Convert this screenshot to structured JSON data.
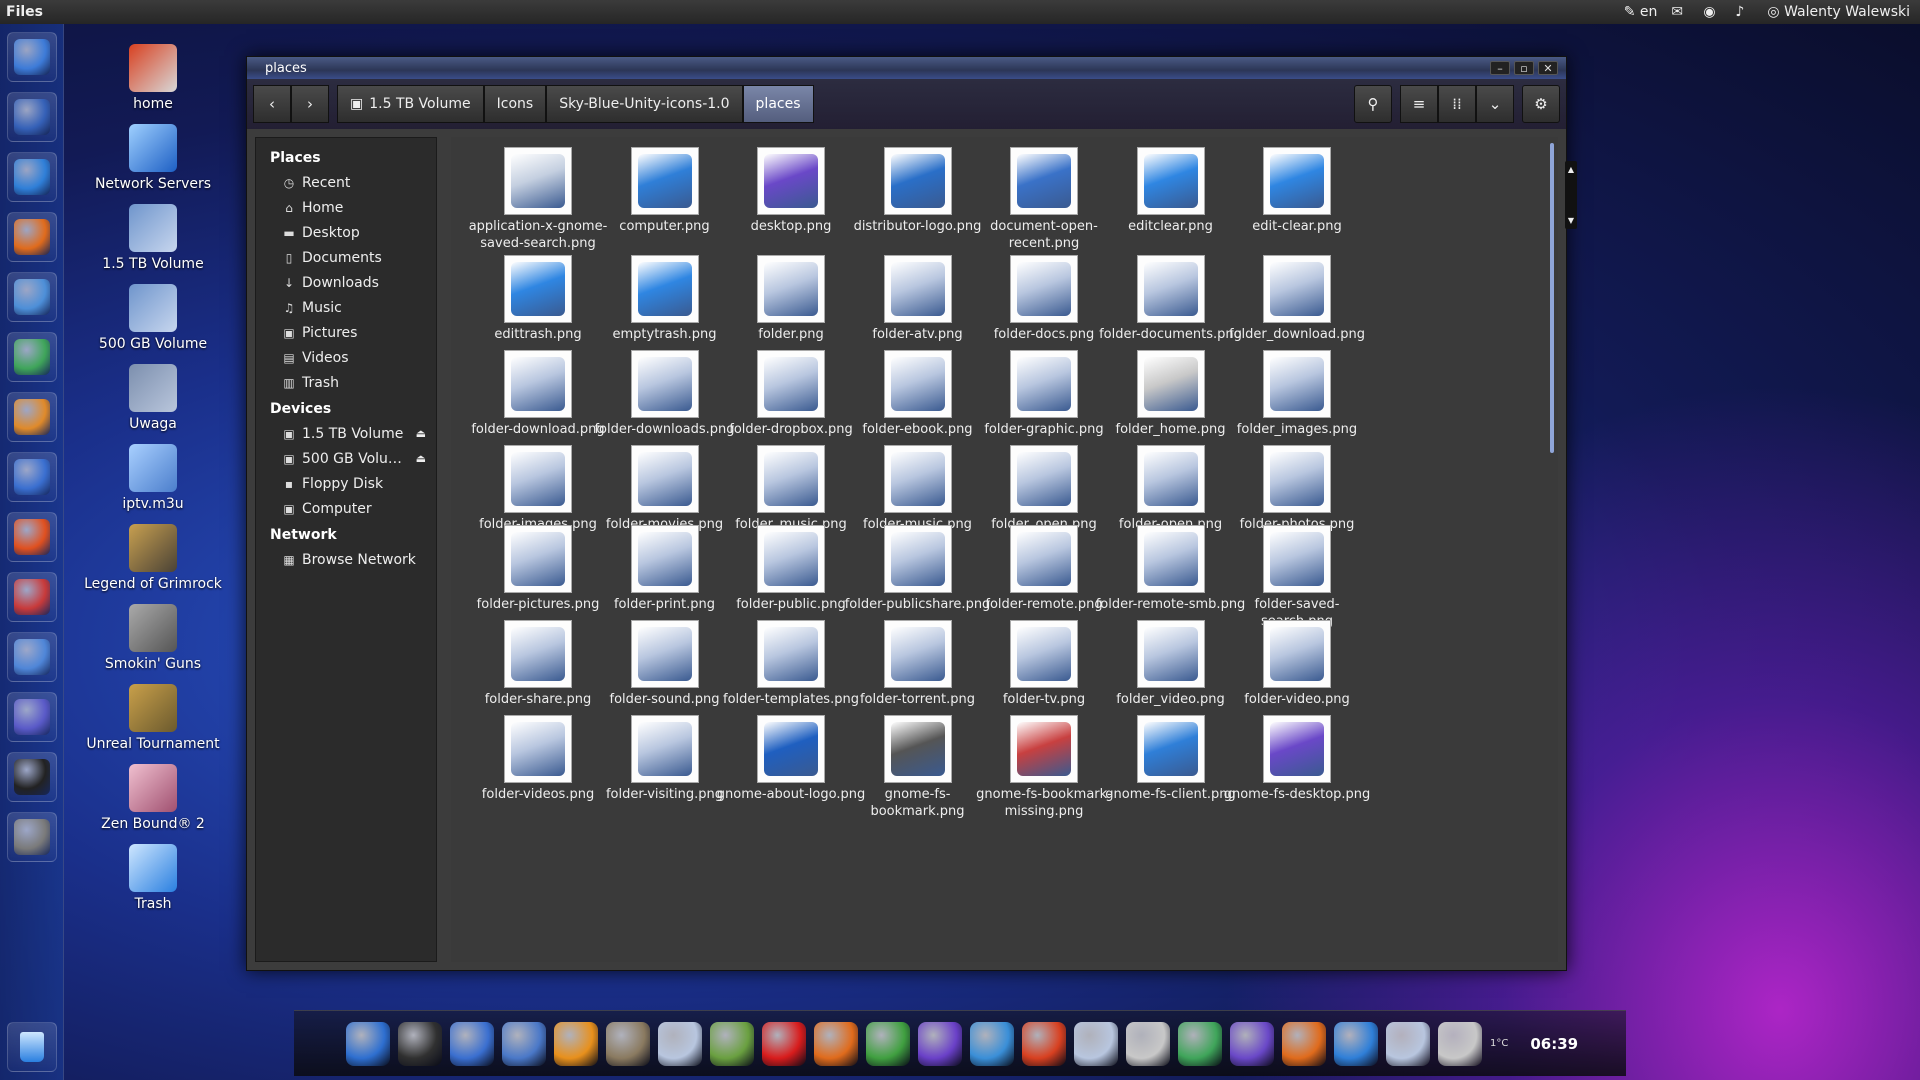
{
  "topbar": {
    "app_title": "Files",
    "keyboard": "en",
    "user": "Walenty Walewski"
  },
  "desktop_icons": [
    {
      "label": "home",
      "color": "#d8d8d8",
      "accent": "#d84020"
    },
    {
      "label": "Network Servers",
      "color": "#1d5fc4",
      "accent": "#9fd0ff"
    },
    {
      "label": "1.5 TB Volume",
      "color": "#c7d6ee",
      "accent": "#6f95cc"
    },
    {
      "label": "500 GB Volume",
      "color": "#c7d6ee",
      "accent": "#6f95cc"
    },
    {
      "label": "Uwaga",
      "color": "#b9c6dc",
      "accent": "#7c8fae"
    },
    {
      "label": "iptv.m3u",
      "color": "#4b7ecc",
      "accent": "#a9d0ff"
    },
    {
      "label": "Legend of Grimrock",
      "color": "#4a4236",
      "accent": "#c8a050"
    },
    {
      "label": "Smokin' Guns",
      "color": "#555555",
      "accent": "#aaaaaa"
    },
    {
      "label": "Unreal Tournament",
      "color": "#6b5a2e",
      "accent": "#c9a04a"
    },
    {
      "label": "Zen Bound® 2",
      "color": "#a05070",
      "accent": "#f0c0d0"
    },
    {
      "label": "Trash",
      "color": "#2a7fe0",
      "accent": "#cfe7ff"
    }
  ],
  "window": {
    "title": "places",
    "breadcrumbs": [
      "1.5 TB Volume",
      "Icons",
      "Sky-Blue-Unity-icons-1.0",
      "places"
    ]
  },
  "sidebar": {
    "places_heading": "Places",
    "places": [
      {
        "label": "Recent",
        "icon": "◷"
      },
      {
        "label": "Home",
        "icon": "⌂"
      },
      {
        "label": "Desktop",
        "icon": "▬"
      },
      {
        "label": "Documents",
        "icon": "▯"
      },
      {
        "label": "Downloads",
        "icon": "↓"
      },
      {
        "label": "Music",
        "icon": "♫"
      },
      {
        "label": "Pictures",
        "icon": "▣"
      },
      {
        "label": "Videos",
        "icon": "▤"
      },
      {
        "label": "Trash",
        "icon": "▥"
      }
    ],
    "devices_heading": "Devices",
    "devices": [
      {
        "label": "1.5 TB Volume",
        "eject": true
      },
      {
        "label": "500 GB Volu…",
        "eject": true
      },
      {
        "label": "Floppy Disk",
        "eject": false
      },
      {
        "label": "Computer",
        "eject": false
      }
    ],
    "network_heading": "Network",
    "network": [
      {
        "label": "Browse Network"
      }
    ]
  },
  "files": [
    {
      "name": "application-x-gnome-saved-search.png",
      "color": "#c4cfe0"
    },
    {
      "name": "computer.png",
      "color": "#2f7fd8"
    },
    {
      "name": "desktop.png",
      "color": "#6a48c8"
    },
    {
      "name": "distributor-logo.png",
      "color": "#2a6fc8"
    },
    {
      "name": "document-open-recent.png",
      "color": "#3a72c8"
    },
    {
      "name": "editclear.png",
      "color": "#2f86e2"
    },
    {
      "name": "edit-clear.png",
      "color": "#2f86e2"
    },
    {
      "name": "edittrash.png",
      "color": "#2f86e2"
    },
    {
      "name": "emptytrash.png",
      "color": "#2f86e2"
    },
    {
      "name": "folder.png",
      "color": "#b8c6df"
    },
    {
      "name": "folder-atv.png",
      "color": "#b8c6df"
    },
    {
      "name": "folder-docs.png",
      "color": "#b8c6df"
    },
    {
      "name": "folder-documents.png",
      "color": "#b8c6df"
    },
    {
      "name": "folder_download.png",
      "color": "#b8c6df"
    },
    {
      "name": "folder-download.png",
      "color": "#b8c6df"
    },
    {
      "name": "folder-downloads.png",
      "color": "#b8c6df"
    },
    {
      "name": "folder-dropbox.png",
      "color": "#b8c6df"
    },
    {
      "name": "folder-ebook.png",
      "color": "#b8c6df"
    },
    {
      "name": "folder-graphic.png",
      "color": "#b8c6df"
    },
    {
      "name": "folder_home.png",
      "color": "#c8c8c8"
    },
    {
      "name": "folder_images.png",
      "color": "#b8c6df"
    },
    {
      "name": "folder-images.png",
      "color": "#b8c6df"
    },
    {
      "name": "folder-movies.png",
      "color": "#b8c6df"
    },
    {
      "name": "folder_music.png",
      "color": "#b8c6df"
    },
    {
      "name": "folder-music.png",
      "color": "#b8c6df"
    },
    {
      "name": "folder_open.png",
      "color": "#b8c6df"
    },
    {
      "name": "folder-open.png",
      "color": "#b8c6df"
    },
    {
      "name": "folder-photos.png",
      "color": "#b8c6df"
    },
    {
      "name": "folder-pictures.png",
      "color": "#b8c6df"
    },
    {
      "name": "folder-print.png",
      "color": "#b8c6df"
    },
    {
      "name": "folder-public.png",
      "color": "#b8c6df"
    },
    {
      "name": "folder-publicshare.png",
      "color": "#b8c6df"
    },
    {
      "name": "folder-remote.png",
      "color": "#b8c6df"
    },
    {
      "name": "folder-remote-smb.png",
      "color": "#b8c6df"
    },
    {
      "name": "folder-saved-search.png",
      "color": "#b8c6df"
    },
    {
      "name": "folder-share.png",
      "color": "#b8c6df"
    },
    {
      "name": "folder-sound.png",
      "color": "#b8c6df"
    },
    {
      "name": "folder-templates.png",
      "color": "#b8c6df"
    },
    {
      "name": "folder-torrent.png",
      "color": "#b8c6df"
    },
    {
      "name": "folder-tv.png",
      "color": "#b8c6df"
    },
    {
      "name": "folder_video.png",
      "color": "#b8c6df"
    },
    {
      "name": "folder-video.png",
      "color": "#b8c6df"
    },
    {
      "name": "folder-videos.png",
      "color": "#b8c6df"
    },
    {
      "name": "folder-visiting.png",
      "color": "#b8c6df"
    },
    {
      "name": "gnome-about-logo.png",
      "color": "#1f5fc0"
    },
    {
      "name": "gnome-fs-bookmark.png",
      "color": "#555555"
    },
    {
      "name": "gnome-fs-bookmark-missing.png",
      "color": "#c84040"
    },
    {
      "name": "gnome-fs-client.png",
      "color": "#2f7fd8"
    },
    {
      "name": "gnome-fs-desktop.png",
      "color": "#6a48c8"
    }
  ],
  "launcher_icons": [
    {
      "name": "ubuntu-logo-icon",
      "color": "#3d7bd8"
    },
    {
      "name": "terminal-monster-icon",
      "color": "#3561b8"
    },
    {
      "name": "globe-icon",
      "color": "#2f7fd8"
    },
    {
      "name": "firefox-icon",
      "color": "#e06b1c"
    },
    {
      "name": "document-icon",
      "color": "#4d8fd8"
    },
    {
      "name": "spreadsheet-icon",
      "color": "#3fa55a"
    },
    {
      "name": "presentation-icon",
      "color": "#e08a2a"
    },
    {
      "name": "media-icon",
      "color": "#3a6fd0"
    },
    {
      "name": "ubuntu-one-icon",
      "color": "#e0501f"
    },
    {
      "name": "tools-icon",
      "color": "#c83a3a"
    },
    {
      "name": "network-icon",
      "color": "#4f86d8"
    },
    {
      "name": "wallpaper-icon",
      "color": "#5a5ac8"
    },
    {
      "name": "terminal-icon",
      "color": "#222222"
    },
    {
      "name": "archive-icon",
      "color": "#7a7a7a"
    }
  ],
  "dock": {
    "icons": [
      {
        "name": "ubuntu-dock-icon",
        "color": "#2e6fd0"
      },
      {
        "name": "terminal-dock-icon",
        "color": "#303030"
      },
      {
        "name": "media-dock-icon",
        "color": "#3a6fd0"
      },
      {
        "name": "photos-dock-icon",
        "color": "#4a78c8"
      },
      {
        "name": "sun-dock-icon",
        "color": "#e8901c"
      },
      {
        "name": "gimp-dock-icon",
        "color": "#8a7a60"
      },
      {
        "name": "files-dock-icon",
        "color": "#b8c6df"
      },
      {
        "name": "contacts-dock-icon",
        "color": "#6aa040"
      },
      {
        "name": "opera-dock-icon",
        "color": "#d81c1c"
      },
      {
        "name": "firefox-dock-icon",
        "color": "#e06b1c"
      },
      {
        "name": "chrome-dock-icon",
        "color": "#40a040"
      },
      {
        "name": "blender-dock-icon",
        "color": "#6a40c8"
      },
      {
        "name": "network-dock-icon",
        "color": "#3a8fd8"
      },
      {
        "name": "home-dock-icon",
        "color": "#d84020"
      },
      {
        "name": "folder-docs-dock-icon",
        "color": "#b8c6df"
      },
      {
        "name": "search-dock-icon",
        "color": "#c8c8c8"
      },
      {
        "name": "download-dock-icon",
        "color": "#3fa55a"
      },
      {
        "name": "desktop-dock-icon",
        "color": "#6a48c8"
      },
      {
        "name": "power-dock-icon",
        "color": "#e06b1c"
      },
      {
        "name": "accessibility-dock-icon",
        "color": "#2f7fd8"
      },
      {
        "name": "folder-dock-icon",
        "color": "#b8c6df"
      },
      {
        "name": "weather-dock-icon",
        "color": "#c8c8c8"
      }
    ],
    "temperature": "1°C",
    "clock": "06:39"
  }
}
